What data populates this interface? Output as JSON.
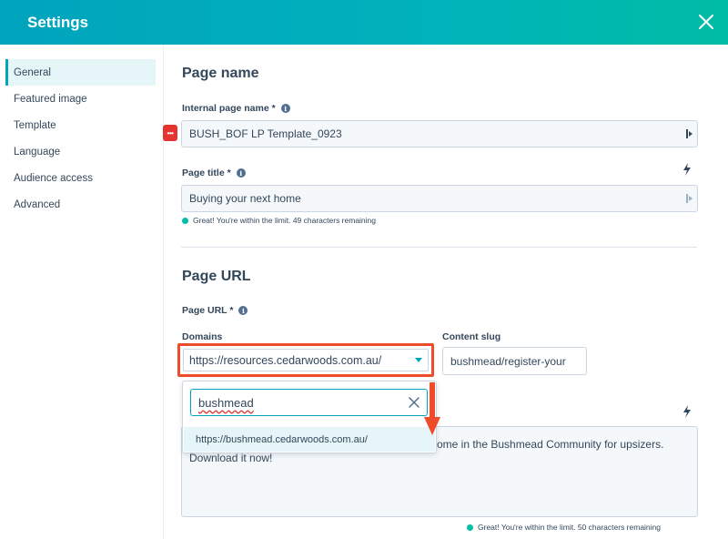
{
  "header": {
    "title": "Settings",
    "close_label": "close"
  },
  "sidebar": {
    "items": [
      {
        "label": "General",
        "active": true
      },
      {
        "label": "Featured image"
      },
      {
        "label": "Template"
      },
      {
        "label": "Language"
      },
      {
        "label": "Audience access"
      },
      {
        "label": "Advanced"
      }
    ]
  },
  "page_name": {
    "heading": "Page name",
    "internal_label": "Internal page name *",
    "internal_value": "BUSH_BOF LP Template_0923",
    "title_label": "Page title *",
    "title_value": "Buying your next home",
    "title_hint": "Great! You're within the limit. 49 characters remaining"
  },
  "page_url": {
    "heading": "Page URL",
    "url_label": "Page URL *",
    "domains_label": "Domains",
    "domain_value": "https://resources.cedarwoods.com.au/",
    "slug_label": "Content slug",
    "slug_value": "bushmead/register-your"
  },
  "dropdown": {
    "search_value": "bushmead",
    "option": "https://bushmead.cedarwoods.com.au/"
  },
  "meta": {
    "line1": "ome in the Bushmead Community for upsizers.",
    "line2": "Download it now!",
    "hint": "Great! You're within the limit. 50 characters remaining"
  },
  "colors": {
    "header_start": "#00a4bd",
    "header_end": "#00bda5",
    "highlight": "#ee4b2b",
    "accent": "#00a4bd"
  }
}
